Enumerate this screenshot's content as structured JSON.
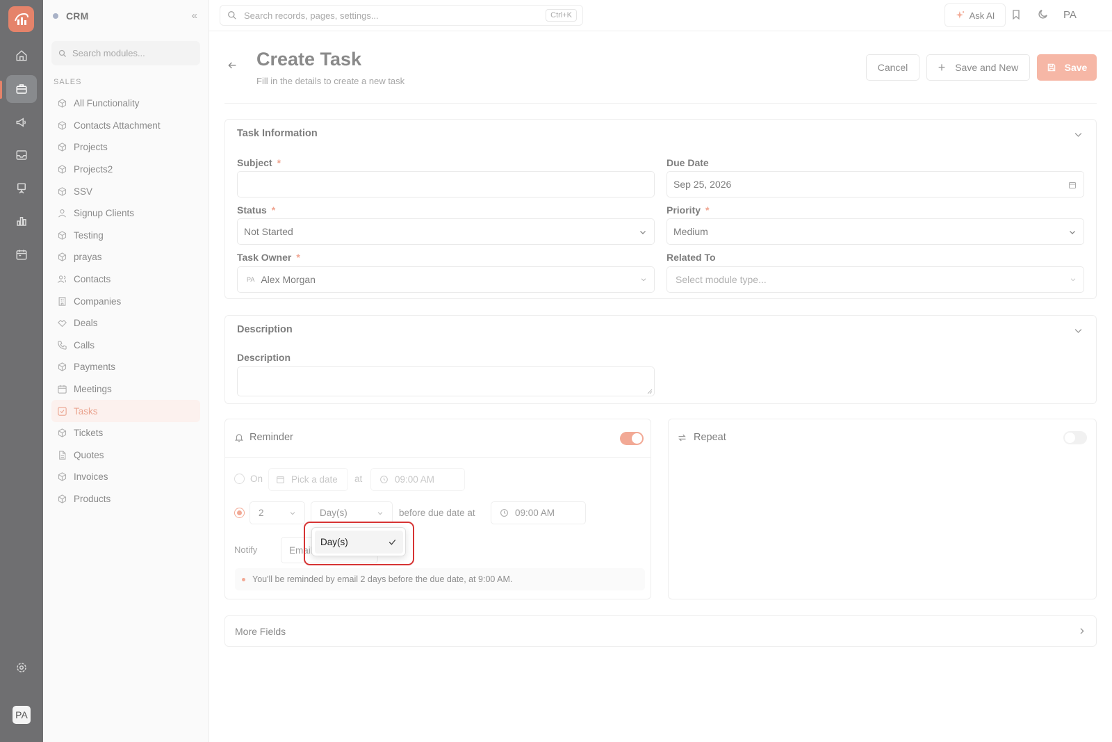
{
  "app": {
    "title": "CRM",
    "user_initials": "PA"
  },
  "sidebar": {
    "search_placeholder": "Search modules...",
    "section": "SALES",
    "items": [
      {
        "label": "All Functionality",
        "icon": "cube-icon"
      },
      {
        "label": "Contacts Attachment",
        "icon": "cube-icon"
      },
      {
        "label": "Projects",
        "icon": "cube-icon"
      },
      {
        "label": "Projects2",
        "icon": "cube-icon"
      },
      {
        "label": "SSV",
        "icon": "cube-icon"
      },
      {
        "label": "Signup Clients",
        "icon": "user-icon"
      },
      {
        "label": "Testing",
        "icon": "cube-icon"
      },
      {
        "label": "prayas",
        "icon": "cube-icon"
      },
      {
        "label": "Contacts",
        "icon": "users-icon"
      },
      {
        "label": "Companies",
        "icon": "building-icon"
      },
      {
        "label": "Deals",
        "icon": "handshake-icon"
      },
      {
        "label": "Calls",
        "icon": "phone-icon"
      },
      {
        "label": "Payments",
        "icon": "cube-icon"
      },
      {
        "label": "Meetings",
        "icon": "calendar-icon"
      },
      {
        "label": "Tasks",
        "icon": "checkbox-icon",
        "active": true
      },
      {
        "label": "Tickets",
        "icon": "cube-icon"
      },
      {
        "label": "Quotes",
        "icon": "file-icon"
      },
      {
        "label": "Invoices",
        "icon": "cube-icon"
      },
      {
        "label": "Products",
        "icon": "cube-icon"
      }
    ]
  },
  "topbar": {
    "search_placeholder": "Search records, pages, settings...",
    "shortcut": "Ctrl+K",
    "ask_ai": "Ask AI",
    "user_initials": "PA"
  },
  "header": {
    "title": "Create Task",
    "subtitle": "Fill in the details to create a new task",
    "cancel": "Cancel",
    "save_and_new": "Save and New",
    "save": "Save"
  },
  "task_info": {
    "title": "Task Information",
    "subject": {
      "label": "Subject",
      "value": ""
    },
    "due_date": {
      "label": "Due Date",
      "value": "Sep 25, 2026"
    },
    "status": {
      "label": "Status",
      "value": "Not Started"
    },
    "priority": {
      "label": "Priority",
      "value": "Medium"
    },
    "owner": {
      "label": "Task Owner",
      "initials": "PA",
      "value": "Alex Morgan"
    },
    "related_to": {
      "label": "Related To",
      "placeholder": "Select module type..."
    }
  },
  "description": {
    "title": "Description",
    "field_label": "Description"
  },
  "reminder": {
    "title": "Reminder",
    "enabled": true,
    "on_label": "On",
    "pick_date": "Pick a date",
    "at_label": "at",
    "on_time": "09:00 AM",
    "amount": "2",
    "unit": "Day(s)",
    "before_label": "before due date at",
    "before_time": "09:00 AM",
    "notify_label": "Notify",
    "notify_value": "Email",
    "hint": "You'll be reminded by email 2 days before the due date, at 9:00 AM.",
    "dropdown_options": [
      "Day(s)"
    ]
  },
  "repeat": {
    "title": "Repeat",
    "enabled": false
  },
  "more_fields": {
    "title": "More Fields"
  },
  "colors": {
    "accent": "#f2a995",
    "rail": "#6f6f71",
    "highlight": "#d63333"
  }
}
